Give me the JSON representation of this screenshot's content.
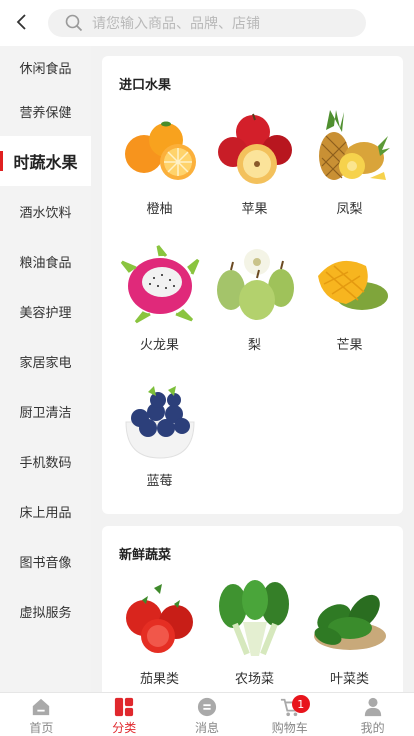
{
  "search": {
    "placeholder": "请您输入商品、品牌、店铺"
  },
  "sidebar": {
    "items": [
      {
        "label": "休闲食品"
      },
      {
        "label": "营养保健"
      },
      {
        "label": "时蔬水果"
      },
      {
        "label": "酒水饮料"
      },
      {
        "label": "粮油食品"
      },
      {
        "label": "美容护理"
      },
      {
        "label": "家居家电"
      },
      {
        "label": "厨卫清洁"
      },
      {
        "label": "手机数码"
      },
      {
        "label": "床上用品"
      },
      {
        "label": "图书音像"
      },
      {
        "label": "虚拟服务"
      }
    ],
    "active_label": "时蔬水果"
  },
  "sections": [
    {
      "title": "进口水果",
      "items": [
        {
          "name": "橙柚",
          "icon": "orange-icon"
        },
        {
          "name": "苹果",
          "icon": "apple-icon"
        },
        {
          "name": "凤梨",
          "icon": "pineapple-icon"
        },
        {
          "name": "火龙果",
          "icon": "dragon-fruit-icon"
        },
        {
          "name": "梨",
          "icon": "pear-icon"
        },
        {
          "name": "芒果",
          "icon": "mango-icon"
        },
        {
          "name": "蓝莓",
          "icon": "blueberry-icon"
        }
      ]
    },
    {
      "title": "新鲜蔬菜",
      "items": [
        {
          "name": "茄果类",
          "icon": "tomato-icon"
        },
        {
          "name": "农场菜",
          "icon": "bok-choy-icon"
        },
        {
          "name": "叶菜类",
          "icon": "spinach-icon"
        }
      ]
    }
  ],
  "tabbar": {
    "items": [
      {
        "label": "首页",
        "icon": "home-icon"
      },
      {
        "label": "分类",
        "icon": "category-icon"
      },
      {
        "label": "消息",
        "icon": "message-icon"
      },
      {
        "label": "购物车",
        "icon": "cart-icon"
      },
      {
        "label": "我的",
        "icon": "profile-icon"
      }
    ],
    "active": "分类",
    "cart_badge": "1"
  },
  "colors": {
    "accent": "#e0282d",
    "icon_gray": "#a9a9a9"
  }
}
